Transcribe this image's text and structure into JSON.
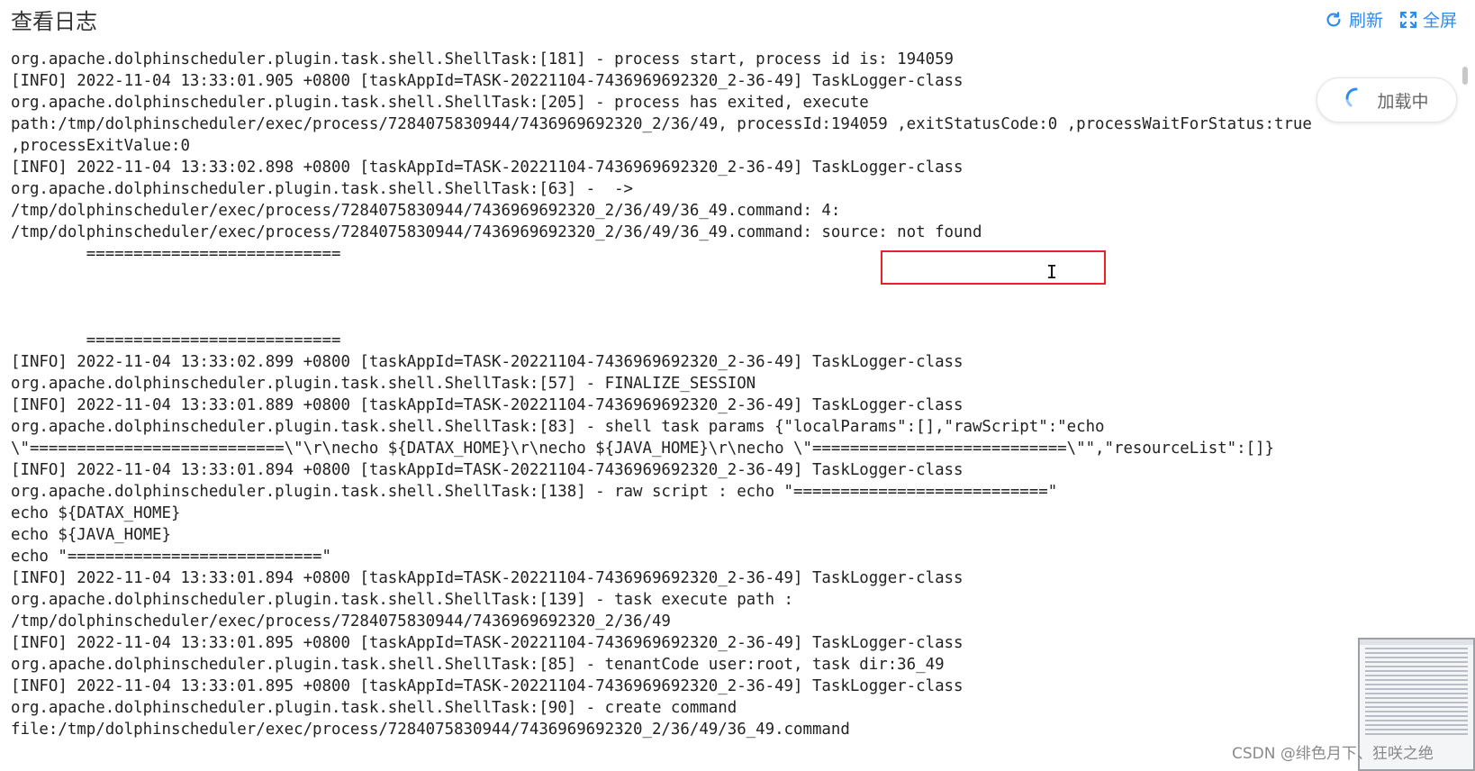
{
  "header": {
    "title": "查看日志",
    "refresh_label": "刷新",
    "fullscreen_label": "全屏"
  },
  "loading_label": "加载中",
  "log": {
    "clipped_top_line": "[INFO] 2022-11-04 13:33:01.889 +0800 [taskAppId=TASK-20221104-7436969692320_2-36-49] TaskLogger-class",
    "lines": [
      "org.apache.dolphinscheduler.plugin.task.shell.ShellTask:[181] - process start, process id is: 194059",
      "[INFO] 2022-11-04 13:33:01.905 +0800 [taskAppId=TASK-20221104-7436969692320_2-36-49] TaskLogger-class",
      "org.apache.dolphinscheduler.plugin.task.shell.ShellTask:[205] - process has exited, execute",
      "path:/tmp/dolphinscheduler/exec/process/7284075830944/7436969692320_2/36/49, processId:194059 ,exitStatusCode:0 ,processWaitForStatus:true",
      ",processExitValue:0",
      "[INFO] 2022-11-04 13:33:02.898 +0800 [taskAppId=TASK-20221104-7436969692320_2-36-49] TaskLogger-class",
      "org.apache.dolphinscheduler.plugin.task.shell.ShellTask:[63] -  ->",
      "/tmp/dolphinscheduler/exec/process/7284075830944/7436969692320_2/36/49/36_49.command: 4:",
      "/tmp/dolphinscheduler/exec/process/7284075830944/7436969692320_2/36/49/36_49.command: source: not found",
      "        ===========================",
      "",
      "",
      "",
      "        ===========================",
      "[INFO] 2022-11-04 13:33:02.899 +0800 [taskAppId=TASK-20221104-7436969692320_2-36-49] TaskLogger-class",
      "org.apache.dolphinscheduler.plugin.task.shell.ShellTask:[57] - FINALIZE_SESSION",
      "[INFO] 2022-11-04 13:33:01.889 +0800 [taskAppId=TASK-20221104-7436969692320_2-36-49] TaskLogger-class",
      "org.apache.dolphinscheduler.plugin.task.shell.ShellTask:[83] - shell task params {\"localParams\":[],\"rawScript\":\"echo",
      "\\\"===========================\\\"\\r\\necho ${DATAX_HOME}\\r\\necho ${JAVA_HOME}\\r\\necho \\\"===========================\\\"\",\"resourceList\":[]}",
      "[INFO] 2022-11-04 13:33:01.894 +0800 [taskAppId=TASK-20221104-7436969692320_2-36-49] TaskLogger-class",
      "org.apache.dolphinscheduler.plugin.task.shell.ShellTask:[138] - raw script : echo \"===========================\"",
      "echo ${DATAX_HOME}",
      "echo ${JAVA_HOME}",
      "echo \"===========================\"",
      "[INFO] 2022-11-04 13:33:01.894 +0800 [taskAppId=TASK-20221104-7436969692320_2-36-49] TaskLogger-class",
      "org.apache.dolphinscheduler.plugin.task.shell.ShellTask:[139] - task execute path :",
      "/tmp/dolphinscheduler/exec/process/7284075830944/7436969692320_2/36/49",
      "[INFO] 2022-11-04 13:33:01.895 +0800 [taskAppId=TASK-20221104-7436969692320_2-36-49] TaskLogger-class",
      "org.apache.dolphinscheduler.plugin.task.shell.ShellTask:[85] - tenantCode user:root, task dir:36_49",
      "[INFO] 2022-11-04 13:33:01.895 +0800 [taskAppId=TASK-20221104-7436969692320_2-36-49] TaskLogger-class",
      "org.apache.dolphinscheduler.plugin.task.shell.ShellTask:[90] - create command",
      "file:/tmp/dolphinscheduler/exec/process/7284075830944/7436969692320_2/36/49/36_49.command"
    ]
  },
  "watermark": "CSDN @绯色月下、狂咲之绝"
}
